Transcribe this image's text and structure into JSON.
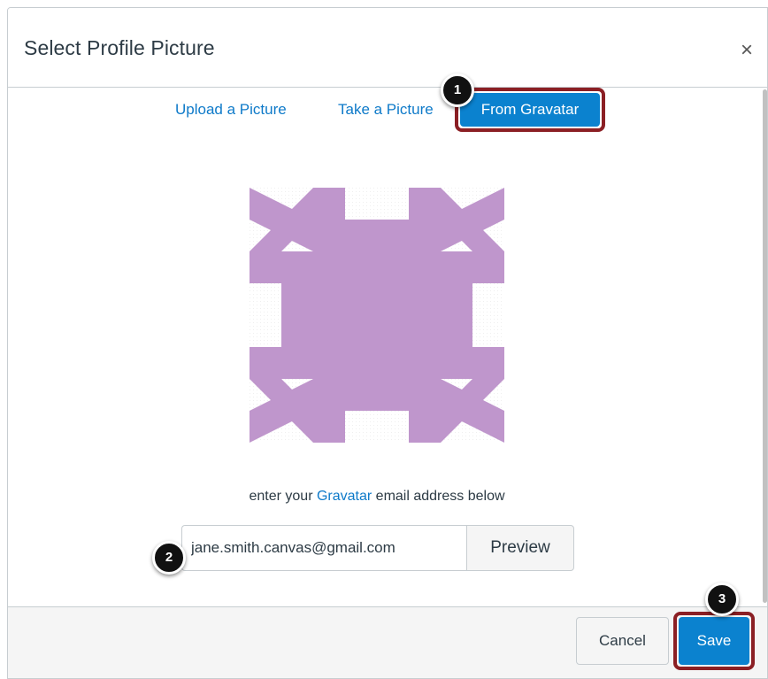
{
  "dialog": {
    "title": "Select Profile Picture",
    "close_label": "×"
  },
  "tabs": [
    {
      "label": "Upload a Picture",
      "active": false
    },
    {
      "label": "Take a Picture",
      "active": false
    },
    {
      "label": "From Gravatar",
      "active": true
    }
  ],
  "callouts": [
    "1",
    "2",
    "3"
  ],
  "gravatar": {
    "prefix": "enter your ",
    "link": "Gravatar",
    "suffix": " email address below",
    "email_value": "jane.smith.canvas@gmail.com",
    "preview_label": "Preview"
  },
  "footer": {
    "cancel_label": "Cancel",
    "save_label": "Save"
  },
  "colors": {
    "accent": "#0b82cf",
    "link": "#0e7ac9",
    "highlight": "#8b1f24",
    "identicon": "#bf96cc"
  },
  "icons": [
    "close-icon",
    "gravatar-identicon"
  ]
}
